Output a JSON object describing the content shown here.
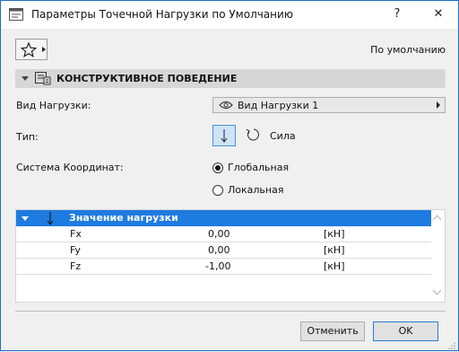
{
  "window": {
    "title": "Параметры Точечной Нагрузки по Умолчанию",
    "help_label": "?",
    "close_label": "✕"
  },
  "toolbar": {
    "default_label": "По умолчанию"
  },
  "section": {
    "title": "КОНСТРУКТИВНОЕ ПОВЕДЕНИЕ"
  },
  "fields": {
    "load_type_label": "Вид Нагрузки:",
    "load_type_value": "Вид Нагрузки 1",
    "type_label": "Тип:",
    "type_force_label": "Сила",
    "coord_label": "Система Координат:",
    "coord_options": [
      {
        "label": "Глобальная",
        "checked": true
      },
      {
        "label": "Локальная",
        "checked": false
      }
    ]
  },
  "table": {
    "header": "Значение нагрузки",
    "rows": [
      {
        "name": "Fx",
        "value": "0,00",
        "unit": "[кН]"
      },
      {
        "name": "Fy",
        "value": "0,00",
        "unit": "[кН]"
      },
      {
        "name": "Fz",
        "value": "-1,00",
        "unit": "[кН]"
      }
    ]
  },
  "buttons": {
    "cancel": "Отменить",
    "ok": "OK"
  },
  "colors": {
    "accent": "#1e7be0",
    "window_border": "#1b6fc8",
    "section_bg": "#d7d7d7"
  }
}
